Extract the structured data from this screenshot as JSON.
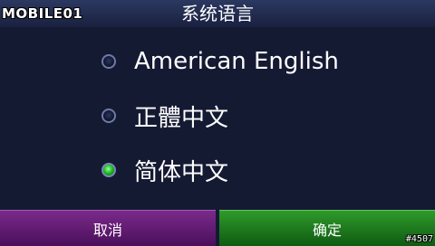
{
  "watermark": "MOBILE01",
  "header": {
    "title": "系统语言"
  },
  "options": [
    {
      "label": "American English",
      "selected": false
    },
    {
      "label": "正體中文",
      "selected": false
    },
    {
      "label": "简体中文",
      "selected": true
    }
  ],
  "buttons": {
    "cancel": "取消",
    "confirm": "确定"
  },
  "badge": "#4507",
  "colors": {
    "background": "#151a33",
    "header": "#2b3860",
    "cancel": "#5a1a6c",
    "confirm": "#1f7a1f",
    "selected_radio": "#22c02a"
  }
}
